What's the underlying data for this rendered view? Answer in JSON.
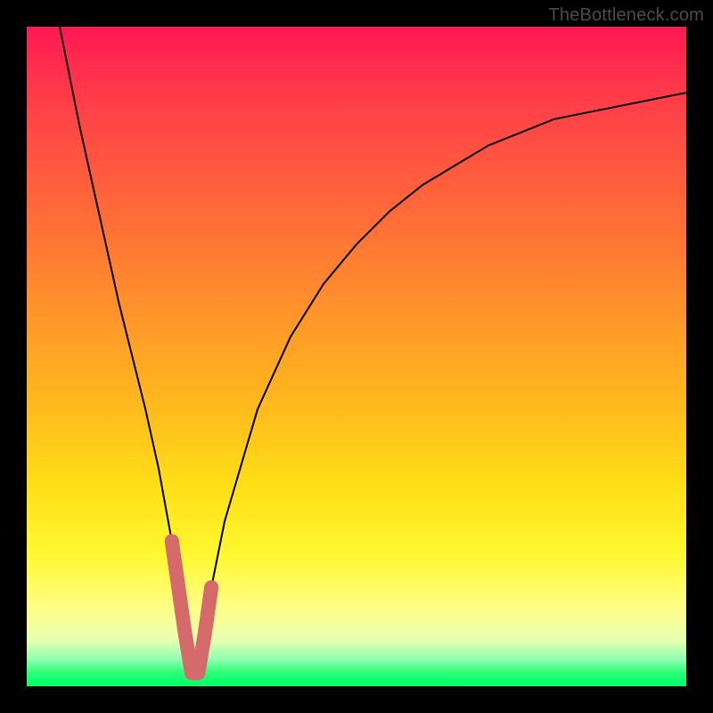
{
  "watermark": "TheBottleneck.com",
  "chart_data": {
    "type": "line",
    "title": "",
    "xlabel": "",
    "ylabel": "",
    "xlim": [
      0,
      100
    ],
    "ylim": [
      0,
      100
    ],
    "series": [
      {
        "name": "bottleneck-curve",
        "x": [
          5,
          8,
          10,
          12,
          14,
          16,
          18,
          20,
          22,
          23,
          24,
          25,
          26,
          27,
          28,
          30,
          35,
          40,
          45,
          50,
          55,
          60,
          65,
          70,
          75,
          80,
          85,
          90,
          95,
          100
        ],
        "values": [
          100,
          85,
          76,
          67,
          58,
          50,
          42,
          33,
          22,
          15,
          8,
          2,
          2,
          8,
          15,
          25,
          42,
          53,
          61,
          67,
          72,
          76,
          79,
          82,
          84,
          86,
          87,
          88,
          89,
          90
        ]
      }
    ],
    "highlight": {
      "name": "optimal-range-marker",
      "color": "#d46a6a",
      "x": [
        22,
        23,
        24,
        25,
        26,
        27,
        28
      ],
      "values": [
        22,
        15,
        8,
        2,
        2,
        8,
        15
      ]
    }
  }
}
